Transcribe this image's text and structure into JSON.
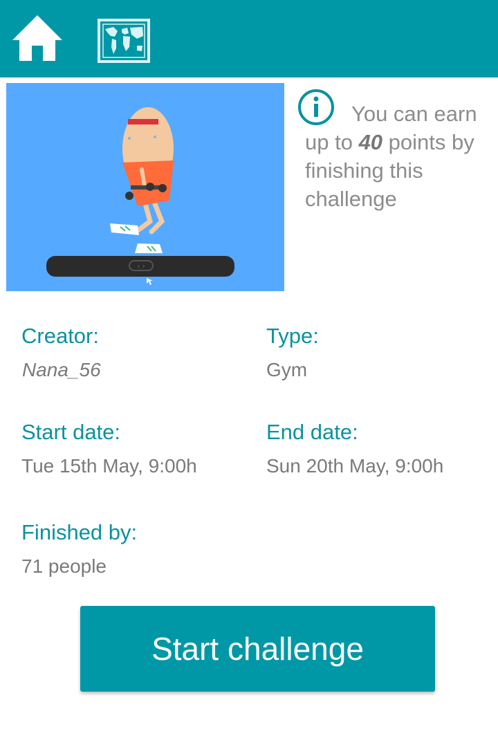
{
  "header": {
    "home_icon": "home-icon",
    "map_icon": "world-map-icon",
    "bar_color": "#0098A6"
  },
  "challenge": {
    "image_icon": "treadmill-runner-illustration",
    "info": {
      "icon": "info-icon",
      "text_before": "You can earn up to ",
      "points": "40",
      "text_after": " points by finishing this challenge"
    },
    "details": {
      "creator_label": "Creator:",
      "creator_value": "Nana_56",
      "type_label": "Type:",
      "type_value": "Gym",
      "start_label": "Start date:",
      "start_value": "Tue 15th May, 9:00h",
      "end_label": "End date:",
      "end_value": "Sun 20th May, 9:00h",
      "finished_label": "Finished by:",
      "finished_value": "71 people"
    }
  },
  "actions": {
    "start_label": "Start challenge"
  },
  "colors": {
    "accent": "#0098A6",
    "label": "#0A929E",
    "muted_text": "#7a7a7a",
    "image_bg": "#55AAFF"
  }
}
